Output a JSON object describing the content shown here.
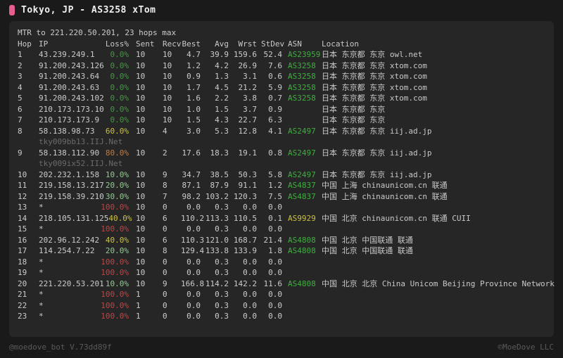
{
  "window": {
    "title": "Tokyo, JP - AS3258 xTom"
  },
  "colors": {
    "accent_pink": "#e85d8f",
    "loss_ok_green": "#3f9b3f",
    "loss_low_green": "#8fcc8f",
    "loss_mid_yellow": "#cdc13f",
    "loss_high_orange": "#c87a3a",
    "loss_full_red": "#c24242",
    "asn_green": "#3fae3f",
    "asn_yellow": "#cdc13f",
    "panel_bg": "#262626",
    "page_bg": "#1a1a1a"
  },
  "table": {
    "summary": "MTR to 221.220.50.201, 23 hops max",
    "columns": [
      "Hop",
      "IP",
      "Loss%",
      "Sent",
      "Recv",
      "Best",
      "Avg",
      "Wrst",
      "StDev",
      "ASN",
      "Location"
    ],
    "rows": [
      {
        "hop": "1",
        "ip": "43.239.249.1",
        "loss": "0.0%",
        "level": "ok",
        "sent": "10",
        "recv": "10",
        "best": "4.7",
        "avg": "39.9",
        "wrst": "159.6",
        "stdev": "52.4",
        "asn": "AS23959",
        "loc": "日本 东京都 东京 owl.net"
      },
      {
        "hop": "2",
        "ip": "91.200.243.126",
        "loss": "0.0%",
        "level": "ok",
        "sent": "10",
        "recv": "10",
        "best": "1.2",
        "avg": "4.2",
        "wrst": "26.9",
        "stdev": "7.6",
        "asn": "AS3258",
        "loc": "日本 东京都 东京 xtom.com"
      },
      {
        "hop": "3",
        "ip": "91.200.243.64",
        "loss": "0.0%",
        "level": "ok",
        "sent": "10",
        "recv": "10",
        "best": "0.9",
        "avg": "1.3",
        "wrst": "3.1",
        "stdev": "0.6",
        "asn": "AS3258",
        "loc": "日本 东京都 东京 xtom.com"
      },
      {
        "hop": "4",
        "ip": "91.200.243.63",
        "loss": "0.0%",
        "level": "ok",
        "sent": "10",
        "recv": "10",
        "best": "1.7",
        "avg": "4.5",
        "wrst": "21.2",
        "stdev": "5.9",
        "asn": "AS3258",
        "loc": "日本 东京都 东京 xtom.com"
      },
      {
        "hop": "5",
        "ip": "91.200.243.102",
        "loss": "0.0%",
        "level": "ok",
        "sent": "10",
        "recv": "10",
        "best": "1.6",
        "avg": "2.2",
        "wrst": "3.8",
        "stdev": "0.7",
        "asn": "AS3258",
        "loc": "日本 东京都 东京 xtom.com"
      },
      {
        "hop": "6",
        "ip": "210.173.173.10",
        "loss": "0.0%",
        "level": "ok",
        "sent": "10",
        "recv": "10",
        "best": "1.0",
        "avg": "1.5",
        "wrst": "3.7",
        "stdev": "0.9",
        "asn": "",
        "loc": "日本 东京都 东京"
      },
      {
        "hop": "7",
        "ip": "210.173.173.9",
        "loss": "0.0%",
        "level": "ok",
        "sent": "10",
        "recv": "10",
        "best": "1.5",
        "avg": "4.3",
        "wrst": "22.7",
        "stdev": "6.3",
        "asn": "",
        "loc": "日本 东京都 东京"
      },
      {
        "hop": "8",
        "ip": "58.138.98.73",
        "host": "tky009bb13.IIJ.Net",
        "loss": "60.0%",
        "level": "mid",
        "sent": "10",
        "recv": "4",
        "best": "3.0",
        "avg": "5.3",
        "wrst": "12.8",
        "stdev": "4.1",
        "asn": "AS2497",
        "loc": "日本 东京都 东京 iij.ad.jp"
      },
      {
        "hop": "9",
        "ip": "58.138.112.90",
        "host": "tky009ix52.IIJ.Net",
        "loss": "80.0%",
        "level": "high",
        "sent": "10",
        "recv": "2",
        "best": "17.6",
        "avg": "18.3",
        "wrst": "19.1",
        "stdev": "0.8",
        "asn": "AS2497",
        "loc": "日本 东京都 东京 iij.ad.jp"
      },
      {
        "hop": "10",
        "ip": "202.232.1.158",
        "loss": "10.0%",
        "level": "low",
        "sent": "10",
        "recv": "9",
        "best": "34.7",
        "avg": "38.5",
        "wrst": "50.3",
        "stdev": "5.8",
        "asn": "AS2497",
        "loc": "日本 东京都 东京 iij.ad.jp"
      },
      {
        "hop": "11",
        "ip": "219.158.13.217",
        "loss": "20.0%",
        "level": "low",
        "sent": "10",
        "recv": "8",
        "best": "87.1",
        "avg": "87.9",
        "wrst": "91.1",
        "stdev": "1.2",
        "asn": "AS4837",
        "loc": "中国 上海 chinaunicom.cn  联通"
      },
      {
        "hop": "12",
        "ip": "219.158.39.210",
        "loss": "30.0%",
        "level": "low",
        "sent": "10",
        "recv": "7",
        "best": "98.2",
        "avg": "103.2",
        "wrst": "120.3",
        "stdev": "7.5",
        "asn": "AS4837",
        "loc": "中国 上海 chinaunicom.cn  联通"
      },
      {
        "hop": "13",
        "ip": "*",
        "loss": "100.0%",
        "level": "full",
        "sent": "10",
        "recv": "0",
        "best": "0.0",
        "avg": "0.3",
        "wrst": "0.0",
        "stdev": "0.0",
        "asn": "",
        "loc": ""
      },
      {
        "hop": "14",
        "ip": "218.105.131.125",
        "loss": "40.0%",
        "level": "mid",
        "sent": "10",
        "recv": "6",
        "best": "110.2",
        "avg": "113.3",
        "wrst": "110.5",
        "stdev": "0.1",
        "asn": "AS9929",
        "asn_style": "asn-yellow",
        "loc": "中国 北京 chinaunicom.cn  联通 CUII"
      },
      {
        "hop": "15",
        "ip": "*",
        "loss": "100.0%",
        "level": "full",
        "sent": "10",
        "recv": "0",
        "best": "0.0",
        "avg": "0.3",
        "wrst": "0.0",
        "stdev": "0.0",
        "asn": "",
        "loc": ""
      },
      {
        "hop": "16",
        "ip": "202.96.12.242",
        "loss": "40.0%",
        "level": "mid",
        "sent": "10",
        "recv": "6",
        "best": "110.3",
        "avg": "121.0",
        "wrst": "168.7",
        "stdev": "21.4",
        "asn": "AS4808",
        "loc": "中国 北京 中国联通 联通"
      },
      {
        "hop": "17",
        "ip": "114.254.7.22",
        "loss": "20.0%",
        "level": "low",
        "sent": "10",
        "recv": "8",
        "best": "129.4",
        "avg": "133.8",
        "wrst": "133.9",
        "stdev": "1.8",
        "asn": "AS4808",
        "loc": "中国 北京 中国联通 联通"
      },
      {
        "hop": "18",
        "ip": "*",
        "loss": "100.0%",
        "level": "full",
        "sent": "10",
        "recv": "0",
        "best": "0.0",
        "avg": "0.3",
        "wrst": "0.0",
        "stdev": "0.0",
        "asn": "",
        "loc": ""
      },
      {
        "hop": "19",
        "ip": "*",
        "loss": "100.0%",
        "level": "full",
        "sent": "10",
        "recv": "0",
        "best": "0.0",
        "avg": "0.3",
        "wrst": "0.0",
        "stdev": "0.0",
        "asn": "",
        "loc": ""
      },
      {
        "hop": "20",
        "ip": "221.220.53.201",
        "loss": "10.0%",
        "level": "low",
        "sent": "10",
        "recv": "9",
        "best": "166.8",
        "avg": "114.2",
        "wrst": "142.2",
        "stdev": "11.6",
        "asn": "AS4808",
        "loc": "中国 北京 北京 China Unicom Beijing Province Network"
      },
      {
        "hop": "21",
        "ip": "*",
        "loss": "100.0%",
        "level": "full",
        "sent": "1",
        "recv": "0",
        "best": "0.0",
        "avg": "0.3",
        "wrst": "0.0",
        "stdev": "0.0",
        "asn": "",
        "loc": ""
      },
      {
        "hop": "22",
        "ip": "*",
        "loss": "100.0%",
        "level": "full",
        "sent": "1",
        "recv": "0",
        "best": "0.0",
        "avg": "0.3",
        "wrst": "0.0",
        "stdev": "0.0",
        "asn": "",
        "loc": ""
      },
      {
        "hop": "23",
        "ip": "*",
        "loss": "100.0%",
        "level": "full",
        "sent": "1",
        "recv": "0",
        "best": "0.0",
        "avg": "0.3",
        "wrst": "0.0",
        "stdev": "0.0",
        "asn": "",
        "loc": ""
      }
    ]
  },
  "footer": {
    "left": "@moedove_bot V.73dd89f",
    "right": "©MoeDove LLC"
  }
}
